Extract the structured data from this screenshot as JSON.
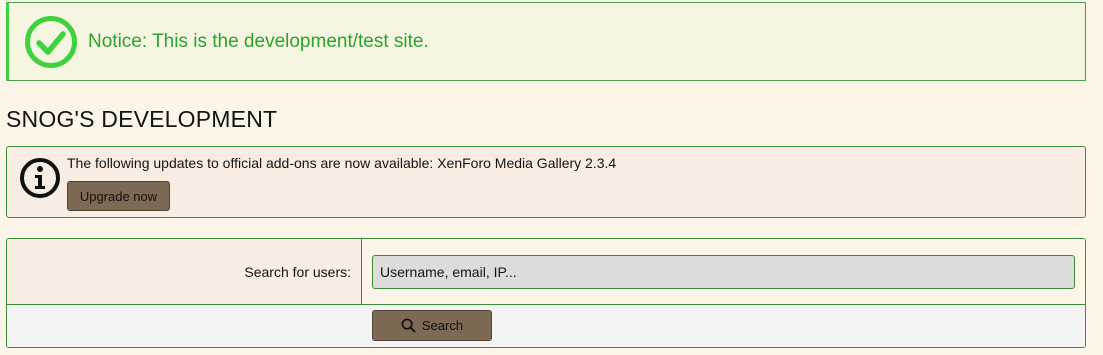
{
  "notice": {
    "icon": "check-circle-icon",
    "text": "Notice: This is the development/test site.",
    "color": "#2ea12e"
  },
  "page": {
    "title": "SNOG'S DEVELOPMENT"
  },
  "update_notice": {
    "icon": "info-icon",
    "text": "The following updates to official add-ons are now available: XenForo Media Gallery 2.3.4",
    "button_label": "Upgrade now"
  },
  "user_search": {
    "label": "Search for users:",
    "placeholder": "Username, email, IP...",
    "value": "",
    "button_icon": "search-icon",
    "button_label": "Search"
  },
  "colors": {
    "background": "#fcf5e8",
    "border": "#3b8e3b",
    "button": "#7d6a54",
    "success": "#3fd13f"
  }
}
